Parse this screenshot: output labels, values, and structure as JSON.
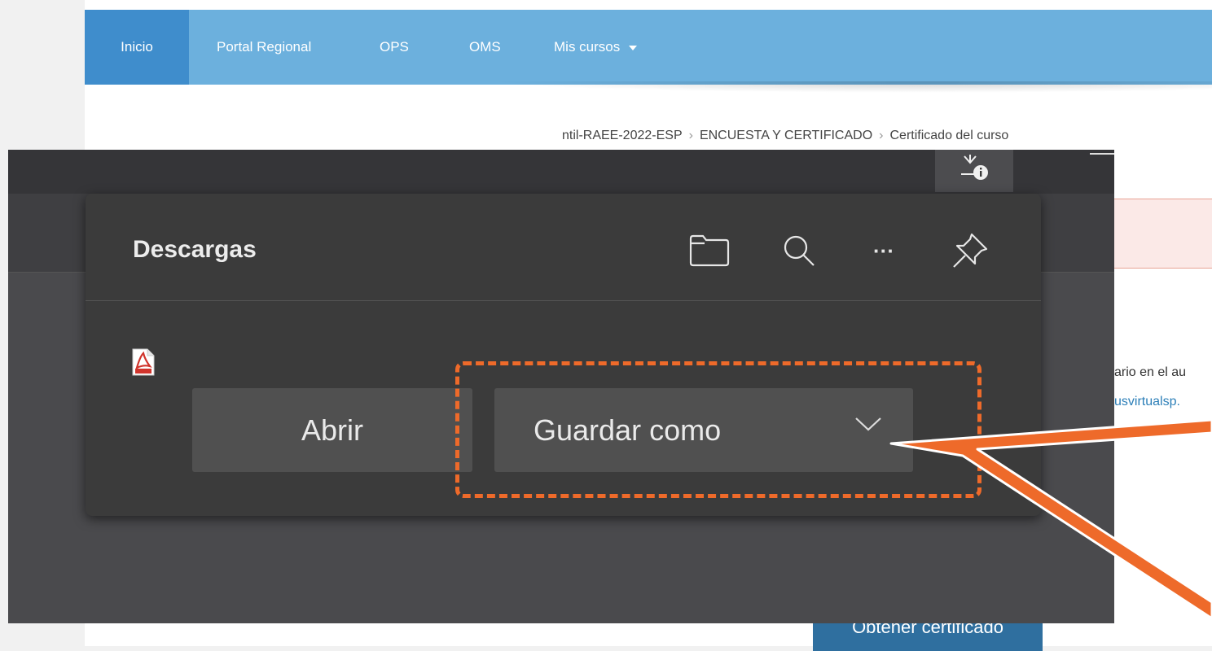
{
  "nav": {
    "items": [
      "Inicio",
      "Portal Regional",
      "OPS",
      "OMS",
      "Mis cursos"
    ],
    "active": "Inicio",
    "dropdown_caret": "caret-down-icon"
  },
  "breadcrumb": [
    "ntil-RAEE-2022-ESP",
    "ENCUESTA Y CERTIFICADO",
    "Certificado del curso"
  ],
  "page": {
    "partial_text": "ario en el au",
    "partial_link": "usvirtualsp.",
    "obtain_button": "Obtener certificado"
  },
  "downloads_panel": {
    "title": "Descargas",
    "header_icons": [
      "folder-icon",
      "search-icon",
      "more-icon",
      "pin-icon"
    ],
    "more_label": "···",
    "file_icon": "pdf-file-icon",
    "open_label": "Abrir",
    "save_as_label": "Guardar como",
    "save_as_chevron": "chevron-down-icon"
  },
  "toolbar": {
    "download_icon": "download-info-icon"
  },
  "colors": {
    "nav_bg": "#6cb0dd",
    "nav_active": "#3f8dcc",
    "panel_bg": "#3b3b3b",
    "button_bg": "#505050",
    "highlight": "#ee6a2a",
    "obtain_button_bg": "#2f6f9f",
    "link": "#2c7fb8"
  }
}
